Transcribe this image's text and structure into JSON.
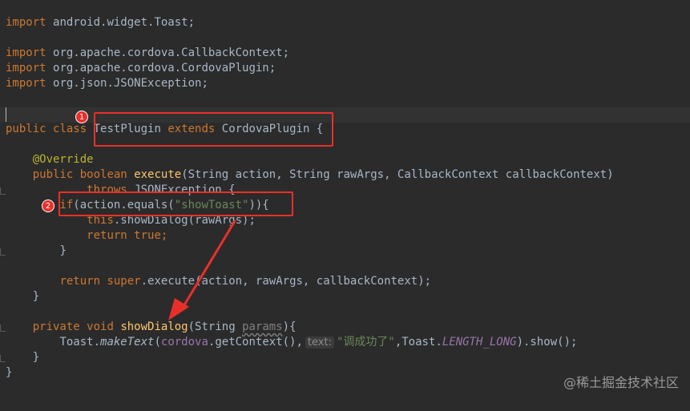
{
  "code": {
    "import_toast": "android.widget.Toast;",
    "import_callback": "org.apache.cordova.CallbackContext;",
    "import_plugin": "org.apache.cordova.CordovaPlugin;",
    "import_json": "org.json.JSONException;",
    "kw_import": "import",
    "kw_public": "public",
    "kw_class": "class",
    "class_name": "TestPlugin",
    "kw_extends": "extends",
    "parent_class": "CordovaPlugin",
    "open_brace": " {",
    "annotation": "@Override",
    "kw_boolean": "boolean",
    "method_execute": "execute",
    "execute_params": "(String action, String rawArgs, CallbackContext callbackContext)",
    "kw_throws": "throws",
    "throws_rest": " JSONException {",
    "kw_if": "if",
    "if_cond_start": "(action.equals(",
    "str_show_toast": "\"showToast\"",
    "if_cond_end": ")){",
    "kw_this": "this",
    "show_dialog_call": ".showDialog(rawArgs);",
    "kw_return": "return",
    "kw_true": "true",
    "semicolon": ";",
    "close_brace": "}",
    "kw_super": "super",
    "super_call_dot": ".",
    "super_execute": "execute",
    "super_args": "(action, rawArgs, callbackContext);",
    "kw_private": "private",
    "kw_void": "void",
    "method_show_dialog": "showDialog",
    "show_dialog_sig_start": "(String ",
    "param_params": "params",
    "show_dialog_sig_end": "){",
    "toast_class": "Toast.",
    "toast_make_text": "makeText",
    "toast_open": "(",
    "field_cordova": "cordova",
    "get_context": ".getContext(),",
    "hint_text": "text:",
    "str_toast_msg": "\"调成功了\"",
    "toast_comma": ",Toast.",
    "const_length_long": "LENGTH_LONG",
    "toast_show": ").show();"
  },
  "annotations": {
    "badge_1": "1",
    "badge_2": "2",
    "color": "#e8302a"
  },
  "watermark": "@稀土掘金技术社区"
}
